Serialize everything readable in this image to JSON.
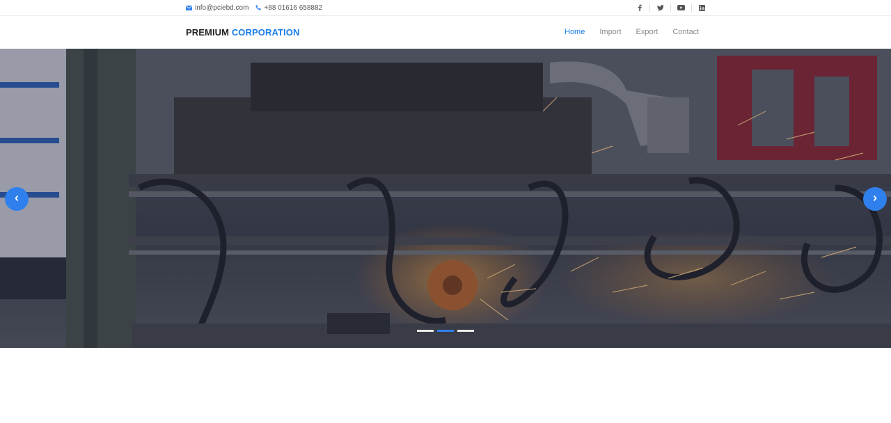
{
  "topbar": {
    "email": "info@pciebd.com",
    "phone": "+88 01616 658882",
    "social": [
      {
        "icon": "facebook-icon"
      },
      {
        "icon": "twitter-icon"
      },
      {
        "icon": "youtube-icon"
      },
      {
        "icon": "linkedin-icon"
      }
    ]
  },
  "brand": {
    "part1": "PREMIUM",
    "part2": "CORPORATION"
  },
  "menu": [
    {
      "label": "Home",
      "active": true
    },
    {
      "label": "Import",
      "active": false
    },
    {
      "label": "Export",
      "active": false
    },
    {
      "label": "Contact",
      "active": false
    }
  ],
  "hero": {
    "image": "industrial-machinery-sparks",
    "prev_icon": "chevron-left-icon",
    "next_icon": "chevron-right-icon",
    "slides_count": 3,
    "active_slide": 2
  },
  "colors": {
    "accent": "#1a7ee6",
    "button": "#2f80ed"
  }
}
